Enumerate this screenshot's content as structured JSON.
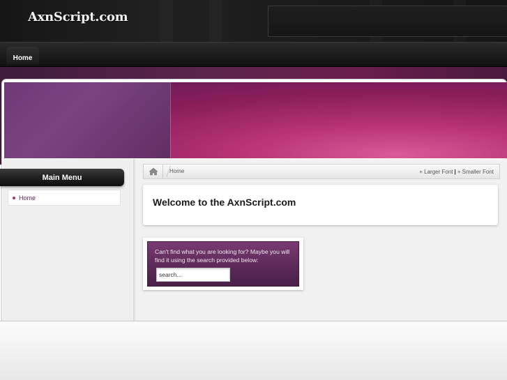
{
  "header": {
    "logo_text": "AxnScript.com"
  },
  "nav": {
    "items": [
      {
        "label": "Home"
      }
    ]
  },
  "sidebar": {
    "title": "Main Menu",
    "items": [
      {
        "label": "Home"
      }
    ]
  },
  "breadcrumb": {
    "current": "Home",
    "font_larger": "+ Larger Font",
    "separator": "|",
    "font_smaller": "+ Smaller Font"
  },
  "main": {
    "welcome_title": "Welcome to the AxnScript.com"
  },
  "search": {
    "prompt": "Can't find what you are looking for? Maybe you will find it using the search provided below:",
    "input_value": "search..."
  },
  "colors": {
    "accent": "#5c2a58",
    "banner": "#b53275",
    "bullet": "#a2327a"
  },
  "icons": {
    "home": "home-icon"
  }
}
